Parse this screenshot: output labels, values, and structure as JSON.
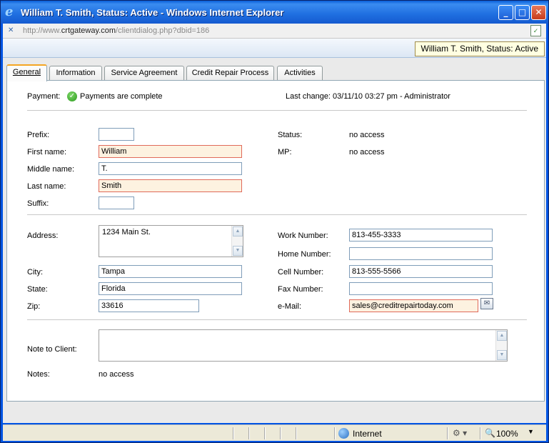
{
  "window": {
    "title": "William T. Smith, Status: Active - Windows Internet Explorer"
  },
  "address": {
    "prefix": "http://www.",
    "domain": "crtgateway.com",
    "path": "/clientdialog.php?dbid=186"
  },
  "tooltip": "William T. Smith, Status: Active",
  "tabs": [
    {
      "label": "General",
      "active": true
    },
    {
      "label": "Information",
      "active": false
    },
    {
      "label": "Service Agreement",
      "active": false
    },
    {
      "label": "Credit Repair Process",
      "active": false
    },
    {
      "label": "Activities",
      "active": false
    }
  ],
  "payment": {
    "label": "Payment:",
    "status": "Payments are complete",
    "last_change": "Last change:  03/11/10 03:27 pm - Administrator"
  },
  "name_section": {
    "prefix_label": "Prefix:",
    "prefix_value": "",
    "first_label": "First name:",
    "first_value": "William",
    "middle_label": "Middle name:",
    "middle_value": "T.",
    "last_label": "Last name:",
    "last_value": "Smith",
    "suffix_label": "Suffix:",
    "suffix_value": "",
    "status_label": "Status:",
    "status_value": "no access",
    "mp_label": "MP:",
    "mp_value": "no access"
  },
  "address_section": {
    "address_label": "Address:",
    "address_value": "1234 Main St.",
    "city_label": "City:",
    "city_value": "Tampa",
    "state_label": "State:",
    "state_value": "Florida",
    "zip_label": "Zip:",
    "zip_value": "33616",
    "work_label": "Work Number:",
    "work_value": "813-455-3333",
    "home_label": "Home Number:",
    "home_value": "",
    "cell_label": "Cell Number:",
    "cell_value": "813-555-5566",
    "fax_label": "Fax Number:",
    "fax_value": "",
    "email_label": "e-Mail:",
    "email_value": "sales@creditrepairtoday.com"
  },
  "notes_section": {
    "note_label": "Note to Client:",
    "note_value": "",
    "notes_label": "Notes:",
    "notes_value": "no access"
  },
  "statusbar": {
    "zone": "Internet",
    "zoom": "100%"
  },
  "colors": {
    "required_border": "#e06a5a",
    "required_bg": "#fdf2e0",
    "tab_accent": "#f5a623"
  }
}
